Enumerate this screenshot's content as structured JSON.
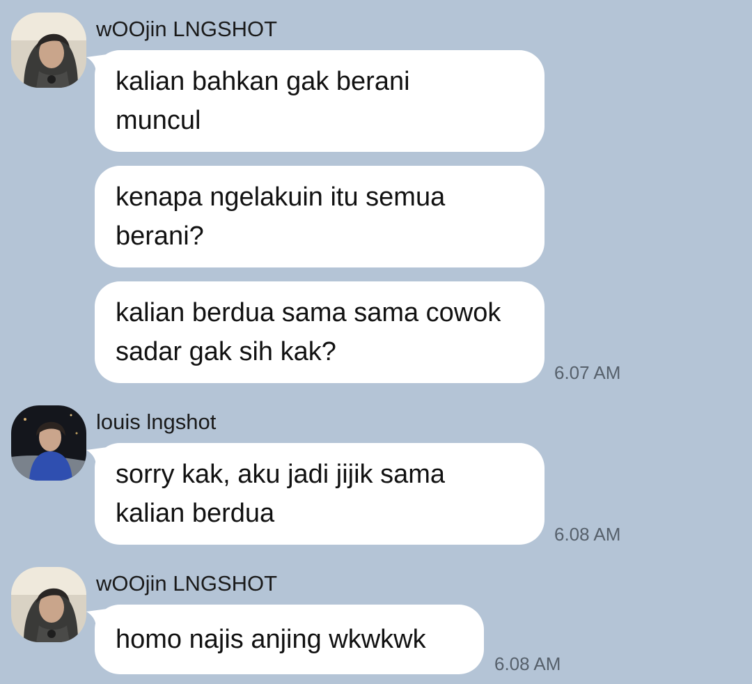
{
  "chat": {
    "groups": [
      {
        "sender": "wOOjin LNGSHOT",
        "avatar": "avatar-woojin",
        "messages": [
          {
            "text": "kalian bahkan gak berani muncul"
          },
          {
            "text": "kenapa ngelakuin itu semua berani?"
          },
          {
            "text": "kalian berdua sama sama cowok sadar gak sih kak?",
            "time": "6.07 AM"
          }
        ]
      },
      {
        "sender": "louis lngshot",
        "avatar": "avatar-louis",
        "messages": [
          {
            "text": "sorry kak, aku jadi jijik sama kalian berdua",
            "time": "6.08 AM"
          }
        ]
      },
      {
        "sender": "wOOjin LNGSHOT",
        "avatar": "avatar-woojin",
        "messages": [
          {
            "text": "homo najis anjing wkwkwk",
            "time": "6.08 AM"
          }
        ]
      }
    ]
  },
  "colors": {
    "background": "#b4c4d6",
    "bubble": "#ffffff",
    "timestamp": "#56606b"
  }
}
